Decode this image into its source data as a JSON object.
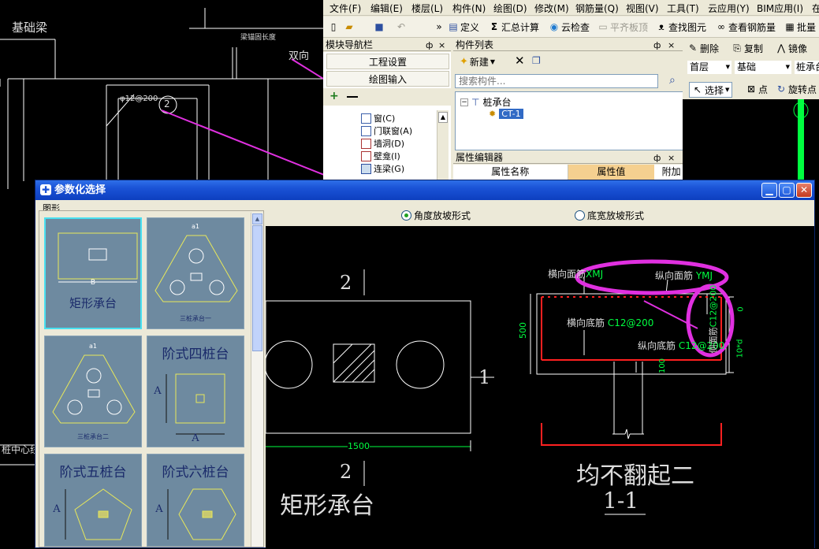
{
  "cad_background": {
    "label_foundation_beam": "基础梁",
    "label_anchor_length": "梁锚固长度",
    "label_double_direction": "双向",
    "label_rebar_spec": "φ12@200",
    "label_circle_no": "2",
    "label_pile_centerline": "桩中心线"
  },
  "app": {
    "menu": [
      "文件(F)",
      "编辑(E)",
      "楼层(L)",
      "构件(N)",
      "绘图(D)",
      "修改(M)",
      "钢筋量(Q)",
      "视图(V)",
      "工具(T)",
      "云应用(Y)",
      "BIM应用(I)",
      "在"
    ],
    "toolbar": {
      "define": "定义",
      "sum_calc": "汇总计算",
      "cloud_check": "云检查",
      "flat_slab": "平齐板顶",
      "find_element": "查找图元",
      "view_rebar": "查看钢筋量",
      "batch": "批量"
    },
    "nav_panel": {
      "title": "模块导航栏",
      "pin": "ф",
      "close": "×",
      "buttons": [
        "工程设置",
        "绘图输入"
      ],
      "add_icon_text": "+",
      "tree_items": [
        "窗(C)",
        "门联窗(A)",
        "墙洞(D)",
        "壁龛(I)",
        "连梁(G)"
      ]
    },
    "component_list": {
      "title": "构件列表",
      "new_button": "新建",
      "search_placeholder": "搜索构件...",
      "tree_root": "桩承台",
      "tree_child": "CT-1"
    },
    "property_editor": {
      "title": "属性编辑器",
      "col_name": "属性名称",
      "col_value": "属性值",
      "col_extra": "附加"
    },
    "right_toolbar": {
      "delete": "删除",
      "copy": "复制",
      "mirror": "镜像",
      "floor_value": "首层",
      "category_value": "基础",
      "element_value": "桩承台",
      "select": "选择",
      "point": "点",
      "rotate_point": "旋转点"
    }
  },
  "dialog": {
    "title": "参数化选择",
    "group_label": "图形",
    "radio_angle": "角度放坡形式",
    "radio_width": "底宽放坡形式",
    "thumbnails": [
      {
        "label": "矩形承台",
        "dim_label": "B"
      },
      {
        "label": "三桩承台一",
        "dim_label": "a1"
      },
      {
        "label": "三桩承台二",
        "dim_label": "a1"
      },
      {
        "label": "阶式四桩台",
        "dim_label": "A"
      },
      {
        "label": "阶式五桩台",
        "dim_label": "A"
      },
      {
        "label": "阶式六桩台",
        "dim_label": "A"
      }
    ],
    "drawing": {
      "section_mark_top": "2",
      "section_mark_bottom": "2",
      "section_mark_side": "1",
      "width_dim": "1500",
      "name": "矩形承台",
      "height_dim": "500",
      "label_h_top": "横向面筋",
      "val_h_top": "XMJ",
      "label_v_top": "纵向面筋",
      "val_v_top": "YMJ",
      "label_side": "侧面筋",
      "val_side": "C12@200",
      "label_h_bottom": "横向底筋",
      "val_h_bottom": "C12@200",
      "label_v_bottom": "纵向底筋",
      "val_v_bottom": "C12@200",
      "dim_zero": "0",
      "dim_10d": "10*d",
      "dim_100": "100",
      "caption": "均不翻起二",
      "section_caption": "1-1"
    }
  },
  "colors": {
    "cad_line": "#ffffff",
    "rebar_red": "#ff2020",
    "rebar_green": "#00ff40",
    "annotation_magenta": "#e030e0",
    "thumb_bg": "#6e8aa0",
    "title_blue": "#1a52d6"
  }
}
